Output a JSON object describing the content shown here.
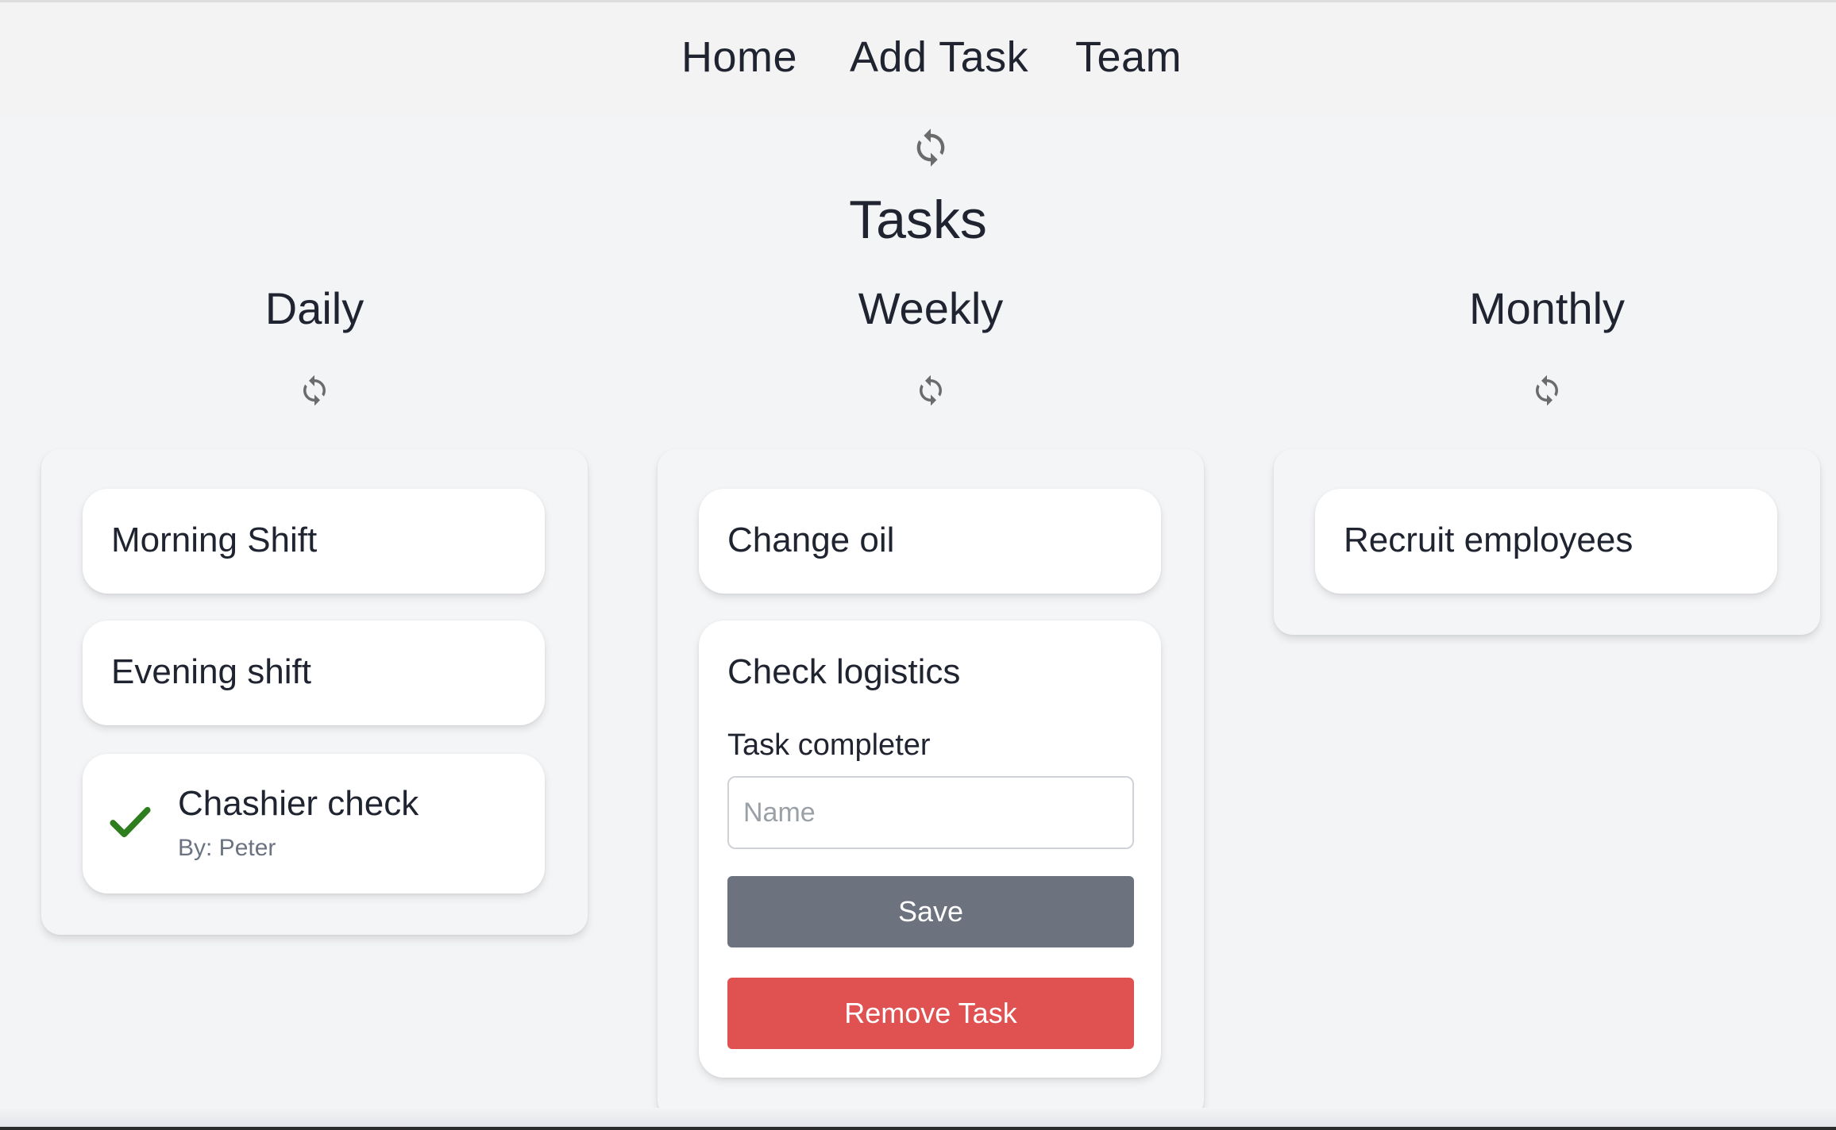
{
  "nav": {
    "home": "Home",
    "add_task": "Add Task",
    "team": "Team"
  },
  "page": {
    "title": "Tasks",
    "refresh_icon": "refresh-icon"
  },
  "columns": [
    {
      "title": "Daily",
      "tasks": [
        {
          "title": "Morning Shift"
        },
        {
          "title": "Evening shift"
        },
        {
          "title": "Chashier check",
          "completed": true,
          "completed_by": "By: Peter",
          "icon": "checkmark-icon"
        }
      ]
    },
    {
      "title": "Weekly",
      "tasks": [
        {
          "title": "Change oil"
        },
        {
          "title": "Check logistics",
          "expanded": true,
          "form": {
            "label": "Task completer",
            "placeholder": "Name",
            "value": "",
            "save_label": "Save",
            "remove_label": "Remove Task"
          }
        }
      ]
    },
    {
      "title": "Monthly",
      "tasks": [
        {
          "title": "Recruit employees"
        }
      ]
    }
  ],
  "colors": {
    "background": "#f3f4f6",
    "card": "#ffffff",
    "save_button": "#6c727e",
    "remove_button": "#e05252",
    "check": "#2e7d1f",
    "refresh_icon": "#6b6b6b"
  }
}
